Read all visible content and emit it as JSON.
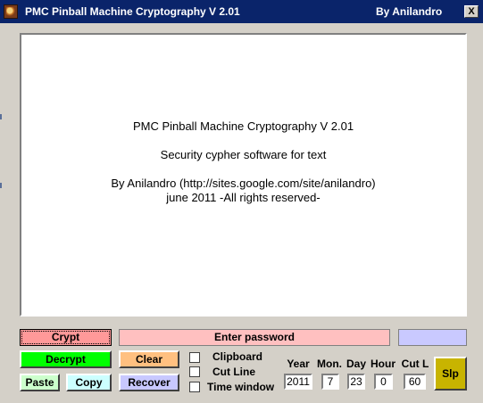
{
  "window": {
    "title": "PMC Pinball Machine Cryptography  V 2.01",
    "author": "By Anilandro",
    "close_label": "X",
    "icon": "pinball-app-icon"
  },
  "main_text": {
    "line1": "PMC Pinball Machine Cryptography V 2.01",
    "line2": "Security cypher software for text",
    "line3": "By Anilandro (http://sites.google.com/site/anilandro)",
    "line4": "june 2011 -All rights reserved-"
  },
  "controls": {
    "crypt_label": "Crypt",
    "password_placeholder": "Enter password",
    "decrypt_label": "Decrypt",
    "clear_label": "Clear",
    "paste_label": "Paste",
    "copy_label": "Copy",
    "recover_label": "Recover",
    "slp_label": "Slp"
  },
  "options": {
    "clipboard_label": "Clipboard",
    "cut_line_label": "Cut Line",
    "time_window_label": "Time window",
    "clipboard_checked": false,
    "cut_line_checked": false,
    "time_window_checked": false
  },
  "time_fields": {
    "year_label": "Year",
    "year_value": "2011",
    "month_label": "Mon.",
    "month_value": "7",
    "day_label": "Day",
    "day_value": "23",
    "hour_label": "Hour",
    "hour_value": "0",
    "cutl_label": "Cut L",
    "cutl_value": "60"
  },
  "colors": {
    "titlebar": "#0a246a",
    "crypt": "#ff9999",
    "password": "#ffc0c0",
    "decrypt": "#00ff00",
    "clear": "#ffc080",
    "paste": "#ccffcc",
    "copy": "#ccffff",
    "recover": "#c8c8ff",
    "slp": "#c8b400"
  }
}
